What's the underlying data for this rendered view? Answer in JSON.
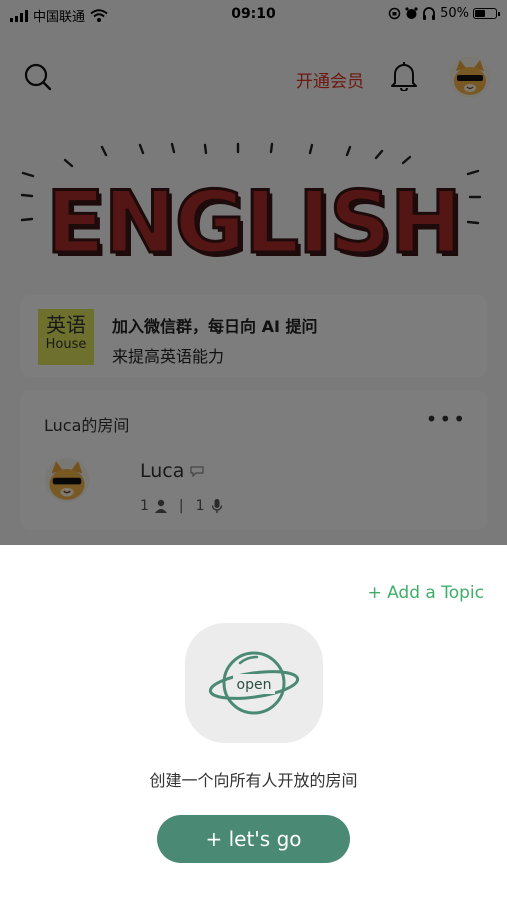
{
  "status_bar": {
    "carrier": "中国联通",
    "time": "09:10",
    "battery_percent": "50%",
    "battery_level": 0.5
  },
  "nav": {
    "vip_label": "开通会员",
    "icons": [
      "search-icon",
      "bell-icon",
      "cool-cat-avatar"
    ]
  },
  "banner": {
    "text": "ENGLISH"
  },
  "wechat_card": {
    "logo_line1": "英语",
    "logo_line2": "House",
    "line1": "加入微信群，每日向 AI 提问",
    "line2": "来提高英语能力"
  },
  "room": {
    "title": "Luca的房间",
    "more": "•••",
    "host": "Luca",
    "listeners": "1",
    "speakers": "1",
    "divider": "|"
  },
  "sheet": {
    "add_topic": "+ Add a Topic",
    "open_label": "open",
    "description": "创建一个向所有人开放的房间",
    "go_label": "+ let's go"
  },
  "colors": {
    "accent_green": "#3fae69",
    "button_green": "#4a8a74",
    "vip_red": "#d9321e",
    "banner_red": "#a92d29"
  }
}
